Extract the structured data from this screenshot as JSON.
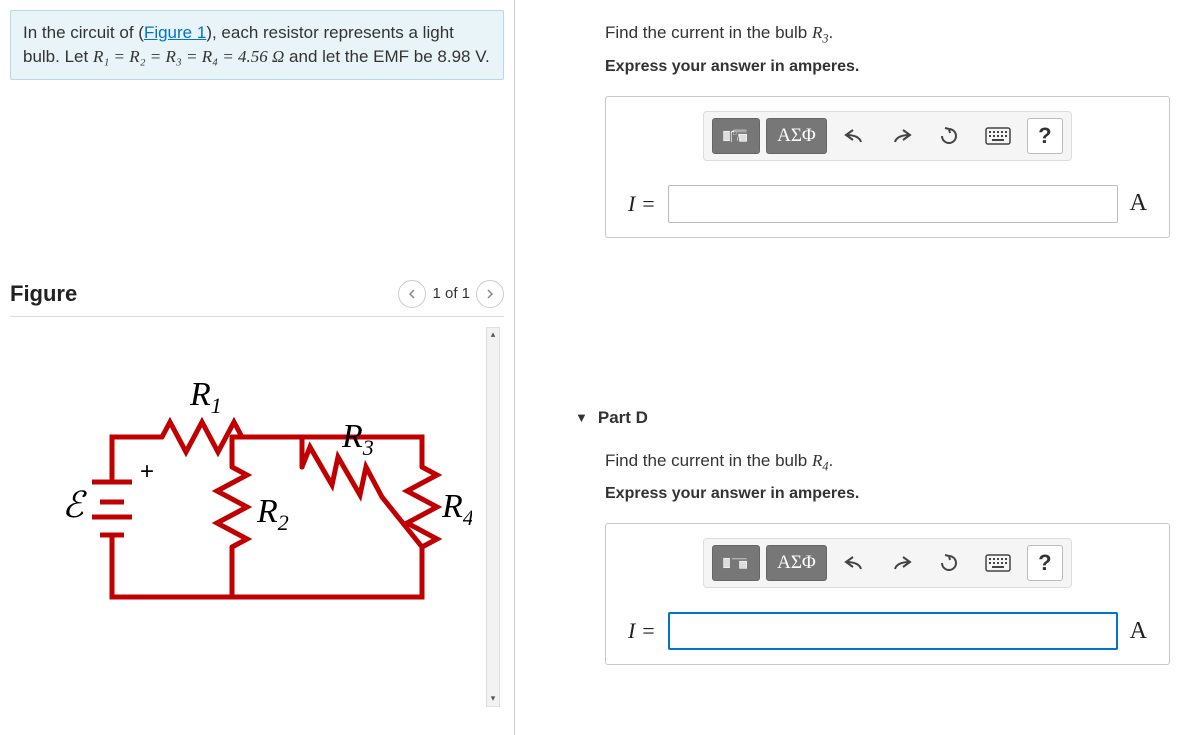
{
  "problem": {
    "line1_pre": "In the circuit of (",
    "figure_link": "Figure 1",
    "line1_post": "), each resistor represents a light bulb. Let ",
    "eq_vars": "R₁ = R₂ = R₃ = R₄ = 4.56 Ω",
    "eq_tail": " and let the EMF be ",
    "emf": "8.98 V",
    "period": "."
  },
  "figure": {
    "title": "Figure",
    "nav_label": "1 of 1",
    "labels": {
      "emf": "ℰ",
      "r1": "R",
      "r2": "R",
      "r3": "R",
      "r4": "R",
      "s1": "1",
      "s2": "2",
      "s3": "3",
      "s4": "4",
      "plus": "+"
    }
  },
  "partC": {
    "prompt_pre": "Find the current in the bulb ",
    "prompt_var": "R",
    "prompt_sub": "3",
    "prompt_post": ".",
    "instruct": "Express your answer in amperes.",
    "toolbar": {
      "greek": "ΑΣΦ",
      "help": "?"
    },
    "var_label": "I =",
    "unit_label": "A",
    "value": ""
  },
  "partD": {
    "header": "Part D",
    "prompt_pre": "Find the current in the bulb ",
    "prompt_var": "R",
    "prompt_sub": "4",
    "prompt_post": ".",
    "instruct": "Express your answer in amperes.",
    "toolbar": {
      "greek": "ΑΣΦ",
      "help": "?"
    },
    "var_label": "I =",
    "unit_label": "A",
    "value": ""
  }
}
